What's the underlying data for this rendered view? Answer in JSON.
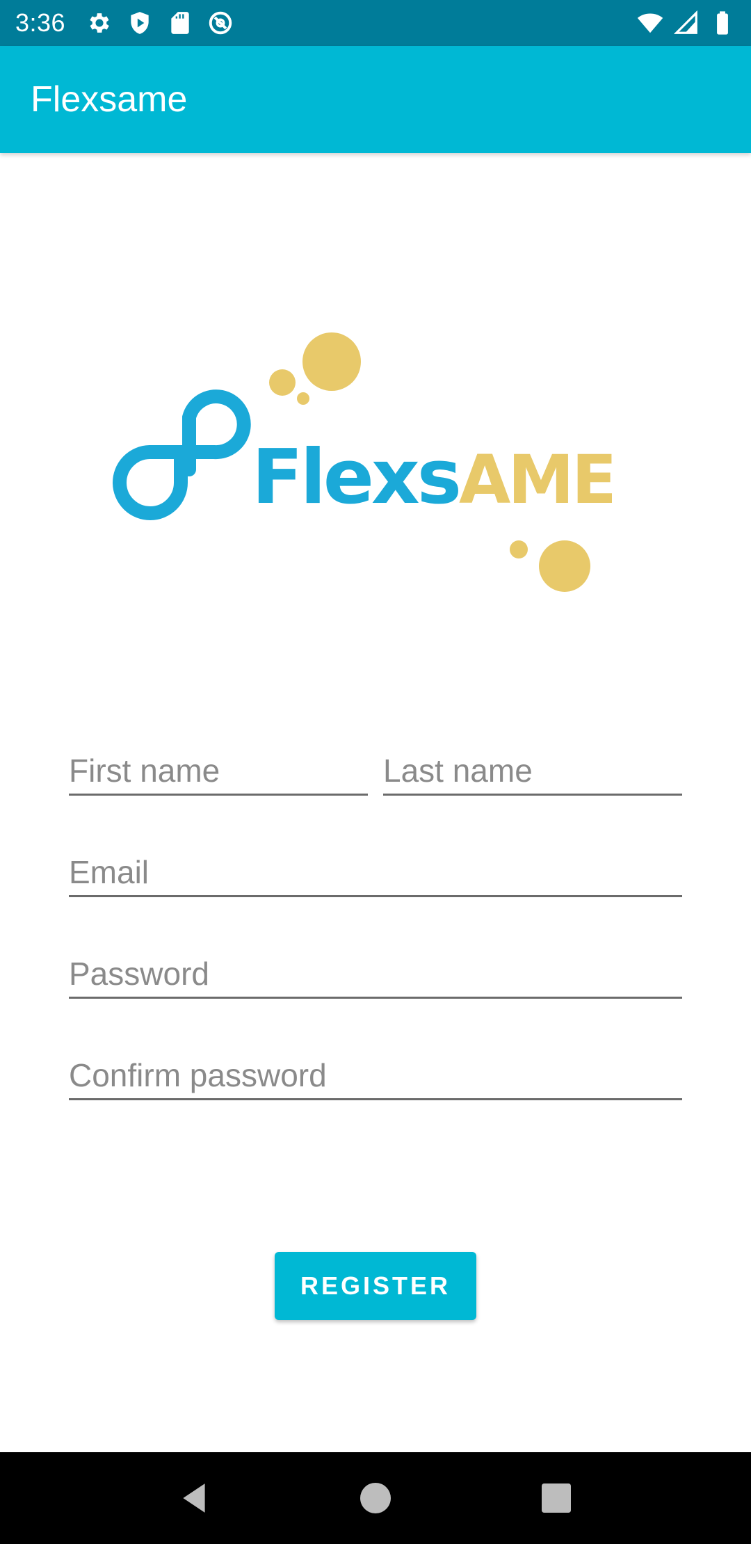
{
  "status_bar": {
    "time": "3:36",
    "left_icons": [
      "gear-icon",
      "shield-icon",
      "sd-card-icon",
      "at-sign-icon"
    ],
    "right_icons": [
      "wifi-icon",
      "signal-icon",
      "battery-icon"
    ]
  },
  "app_bar": {
    "title": "Flexsame"
  },
  "logo": {
    "text_primary": "Flexs",
    "text_accent": "AME",
    "primary_color": "#1ba9d8",
    "accent_color": "#e8c96a"
  },
  "form": {
    "first_name_placeholder": "First name",
    "last_name_placeholder": "Last name",
    "email_placeholder": "Email",
    "password_placeholder": "Password",
    "confirm_password_placeholder": "Confirm password"
  },
  "actions": {
    "register_label": "REGISTER"
  },
  "colors": {
    "status_bar": "#007c99",
    "app_bar": "#00b8d4",
    "button": "#00b8d4"
  },
  "nav_bar": {
    "buttons": [
      "back-icon",
      "home-icon",
      "recents-icon"
    ]
  }
}
